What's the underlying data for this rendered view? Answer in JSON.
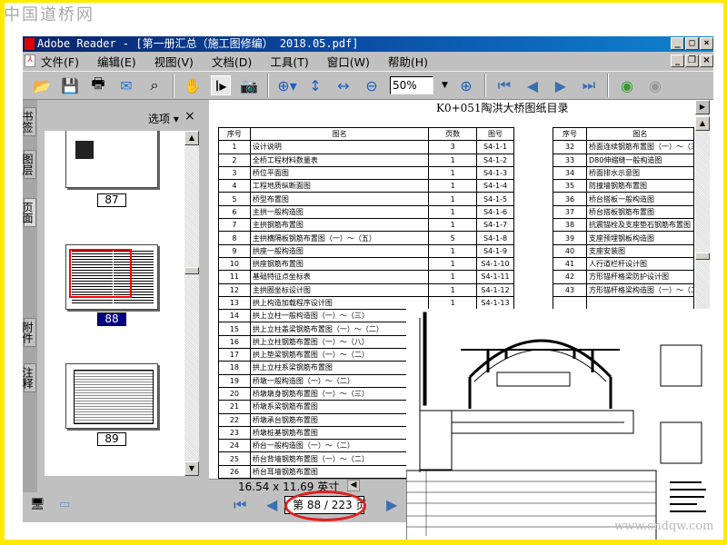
{
  "watermark": "中国道桥网",
  "watermark2": "www.cndqw.com",
  "window": {
    "title": "Adobe Reader - [第一册汇总（施工图修编） 2018.05.pdf]",
    "controls": [
      "_",
      "□",
      "×"
    ],
    "doc_controls": [
      "_",
      "❐",
      "×"
    ]
  },
  "menu": [
    "文件(F)",
    "编辑(E)",
    "视图(V)",
    "文档(D)",
    "工具(T)",
    "窗口(W)",
    "帮助(H)"
  ],
  "toolbar": {
    "zoom": "50%",
    "icons": [
      "open-icon",
      "save-icon",
      "print-icon",
      "email-icon",
      "search-icon",
      "hand-icon",
      "select-text-icon",
      "snapshot-icon",
      "zoom-in-tool-icon",
      "fit-height-icon",
      "fit-width-icon",
      "zoom-out-icon",
      "zoom-plus-icon",
      "first-page-icon",
      "prev-page-icon",
      "next-page-icon",
      "last-page-icon",
      "back-icon",
      "forward-icon"
    ]
  },
  "side_tabs": [
    "书签",
    "图层",
    "页面",
    "附件",
    "注释"
  ],
  "nav": {
    "options": "选项 ▾",
    "close": "×",
    "pages": [
      "87",
      "88",
      "89"
    ],
    "selected": "88"
  },
  "document": {
    "title": "K0+051陶洪大桥图纸目录",
    "headers": [
      "序号",
      "图名",
      "页数",
      "图号"
    ],
    "rows": [
      [
        "1",
        "设计说明",
        "3",
        "S4-1-1"
      ],
      [
        "2",
        "全桥工程材料数量表",
        "1",
        "S4-1-2"
      ],
      [
        "3",
        "桥位平面图",
        "1",
        "S4-1-3"
      ],
      [
        "4",
        "工程地质纵断面图",
        "1",
        "S4-1-4"
      ],
      [
        "5",
        "桥型布置图",
        "1",
        "S4-1-5"
      ],
      [
        "6",
        "主拱一般构造图",
        "1",
        "S4-1-6"
      ],
      [
        "7",
        "主拱钢筋布置图",
        "1",
        "S4-1-7"
      ],
      [
        "8",
        "主拱横隔板钢筋布置图（一）～（五）",
        "5",
        "S4-1-8"
      ],
      [
        "9",
        "拱座一般构造图",
        "1",
        "S4-1-9"
      ],
      [
        "10",
        "拱座钢筋布置图",
        "1",
        "S4-1-10"
      ],
      [
        "11",
        "基础特征点坐标表",
        "1",
        "S4-1-11"
      ],
      [
        "12",
        "主拱圈坐标设计图",
        "1",
        "S4-1-12"
      ],
      [
        "13",
        "拱上构造加载程序设计图",
        "1",
        "S4-1-13"
      ],
      [
        "14",
        "拱上立柱一般构造图（一）～（三）",
        "",
        ""
      ],
      [
        "15",
        "拱上立柱盖梁钢筋布置图（一）～（二）",
        "",
        ""
      ],
      [
        "16",
        "拱上立柱钢筋布置图（一）～（八）",
        "",
        ""
      ],
      [
        "17",
        "拱上垫梁钢筋布置图（一）～（二）",
        "",
        ""
      ],
      [
        "18",
        "拱上立柱系梁钢筋布置图",
        "",
        ""
      ],
      [
        "19",
        "桥墩一般构造图（一）～（二）",
        "",
        ""
      ],
      [
        "20",
        "桥墩墩身钢筋布置图（一）～（三）",
        "",
        ""
      ],
      [
        "21",
        "桥墩系梁钢筋布置图",
        "",
        ""
      ],
      [
        "22",
        "桥墩承台钢筋布置图",
        "",
        ""
      ],
      [
        "23",
        "桥墩桩基钢筋布置图",
        "",
        ""
      ],
      [
        "24",
        "桥台一般构造图（一）～（二）",
        "",
        ""
      ],
      [
        "25",
        "桥台背墙钢筋布置图（一）～（二）",
        "",
        ""
      ],
      [
        "26",
        "桥台耳墙钢筋布置图",
        "",
        ""
      ]
    ],
    "right_headers": [
      "序号",
      "图名"
    ],
    "right_rows": [
      [
        "32",
        "桥面连续钢筋布置图（一）～（三）"
      ],
      [
        "33",
        "D80伸缩缝一般构造图"
      ],
      [
        "34",
        "桥面排水示意图"
      ],
      [
        "35",
        "防撞墙钢筋布置图"
      ],
      [
        "36",
        "桥台搭板一般构造图"
      ],
      [
        "37",
        "桥台搭板钢筋布置图"
      ],
      [
        "38",
        "抗震锚栓及支座垫石钢筋布置图"
      ],
      [
        "39",
        "支座预埋钢板构造图"
      ],
      [
        "40",
        "支座安装图"
      ],
      [
        "41",
        "人行道栏杆设计图"
      ],
      [
        "42",
        "方形锚杆格梁防护设计图"
      ],
      [
        "43",
        "方形锚杆格梁构造图（一）～（二）"
      ]
    ]
  },
  "status": {
    "page_size": "16.54 x 11.69 英寸",
    "page_display": "第 88 / 223 页"
  },
  "colors": {
    "title_bar": "#0a246a",
    "highlight": "#e02020",
    "frame": "#ffea00",
    "selected_page": "#000080"
  }
}
